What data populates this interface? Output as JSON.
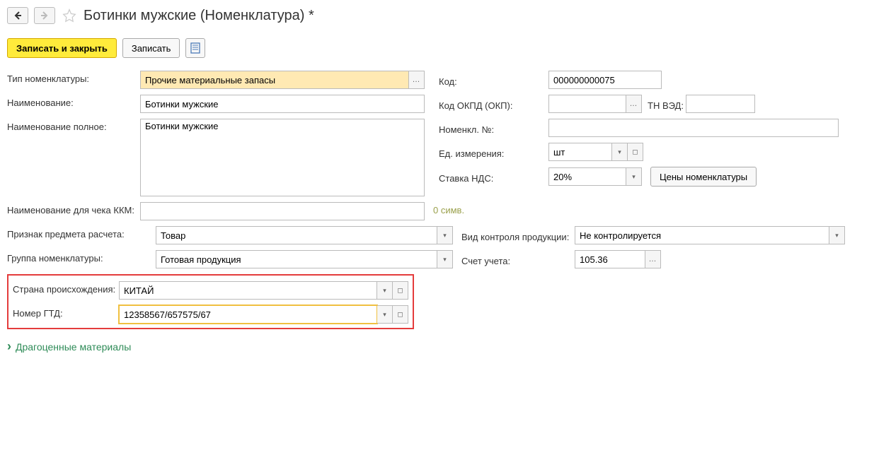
{
  "header": {
    "title": "Ботинки мужские (Номенклатура) *"
  },
  "toolbar": {
    "save_close": "Записать и закрыть",
    "save": "Записать"
  },
  "fields": {
    "type_label": "Тип номенклатуры:",
    "type_value": "Прочие материальные запасы",
    "code_label": "Код:",
    "code_value": "000000000075",
    "name_label": "Наименование:",
    "name_value": "Ботинки мужские",
    "okpd_label": "Код ОКПД (ОКП):",
    "okpd_value": "",
    "tnved_label": "ТН ВЭД:",
    "tnved_value": "",
    "fullname_label": "Наименование полное:",
    "fullname_value": "Ботинки мужские",
    "nomnum_label": "Номенкл. №:",
    "nomnum_value": "",
    "unit_label": "Ед. измерения:",
    "unit_value": "шт",
    "vat_label": "Ставка НДС:",
    "vat_value": "20%",
    "prices_btn": "Цены номенклатуры",
    "kkm_label": "Наименование для чека ККМ:",
    "kkm_value": "",
    "kkm_hint": "0 симв.",
    "subject_label": "Признак предмета расчета:",
    "subject_value": "Товар",
    "control_label": "Вид контроля продукции:",
    "control_value": "Не контролируется",
    "group_label": "Группа номенклатуры:",
    "group_value": "Готовая продукция",
    "account_label": "Счет учета:",
    "account_value": "105.36",
    "country_label": "Страна происхождения:",
    "country_value": "КИТАЙ",
    "gtd_label": "Номер ГТД:",
    "gtd_value": "12358567/657575/67"
  },
  "sections": {
    "precious": "Драгоценные материалы"
  }
}
